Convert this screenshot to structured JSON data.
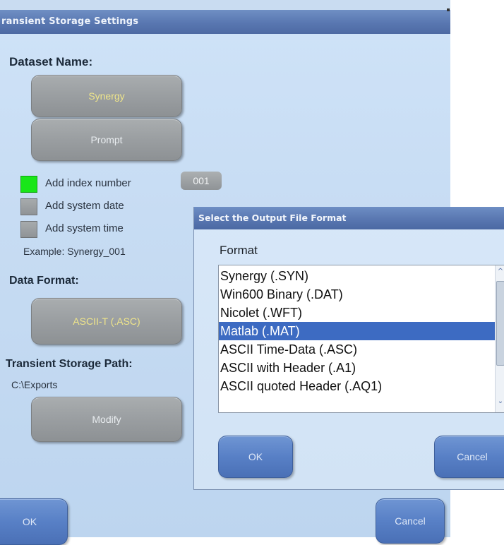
{
  "main": {
    "title": "ransient Storage Settings",
    "dataset_name_label": "Dataset Name:",
    "dataset_name_value": "Synergy",
    "prompt_button": "Prompt",
    "add_index_label": "Add index number",
    "index_value": "001",
    "add_date_label": "Add system date",
    "add_time_label": "Add system time",
    "example_text": "Example: Synergy_001",
    "data_format_label": "Data Format:",
    "data_format_value": "ASCII-T (.ASC)",
    "path_label": "Transient Storage Path:",
    "path_value": "C:\\Exports",
    "modify_button": "Modify",
    "ok_button": "OK",
    "cancel_button": "Cancel",
    "checkboxes": {
      "add_index": true,
      "add_date": false,
      "add_time": false
    }
  },
  "dialog": {
    "title": "Select the Output File Format",
    "format_label": "Format",
    "items": [
      "Synergy (.SYN)",
      "Win600 Binary (.DAT)",
      "Nicolet (.WFT)",
      "Matlab (.MAT)",
      "ASCII Time-Data (.ASC)",
      "ASCII with Header (.A1)",
      "ASCII quoted Header (.AQ1)"
    ],
    "selected": "Matlab (.MAT)",
    "ok_button": "OK",
    "cancel_button": "Cancel"
  },
  "colors": {
    "title_bar": "#5977b1",
    "window_bg": "#c7dcf3",
    "selection": "#3d6bc2",
    "checkbox_on": "#19e619",
    "gray_button": "#9a9ea1",
    "blue_button": "#5880c6"
  },
  "icons": [
    "scroll-up-icon",
    "scroll-down-icon"
  ]
}
